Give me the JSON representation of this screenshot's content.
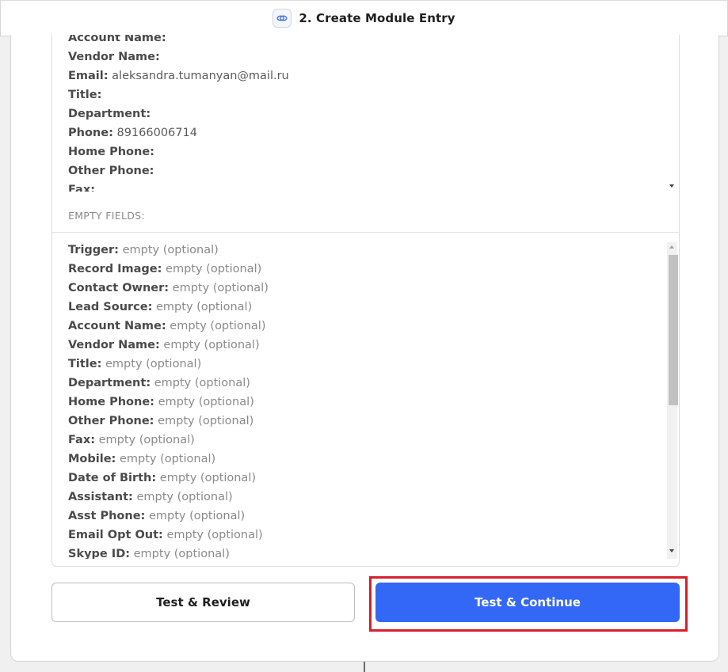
{
  "header": {
    "title": "2. Create Module Entry",
    "icon": "link-chain-icon"
  },
  "filled_fields": [
    {
      "label": "Account Name:",
      "value": ""
    },
    {
      "label": "Vendor Name:",
      "value": ""
    },
    {
      "label": "Email:",
      "value": "aleksandra.tumanyan@mail.ru"
    },
    {
      "label": "Title:",
      "value": ""
    },
    {
      "label": "Department:",
      "value": ""
    },
    {
      "label": "Phone:",
      "value": "89166006714"
    },
    {
      "label": "Home Phone:",
      "value": ""
    },
    {
      "label": "Other Phone:",
      "value": ""
    },
    {
      "label": "Fax:",
      "value": ""
    }
  ],
  "empty_section_label": "EMPTY FIELDS:",
  "empty_fields": [
    {
      "label": "Trigger:",
      "value": "empty (optional)"
    },
    {
      "label": "Record Image:",
      "value": "empty (optional)"
    },
    {
      "label": "Contact Owner:",
      "value": "empty (optional)"
    },
    {
      "label": "Lead Source:",
      "value": "empty (optional)"
    },
    {
      "label": "Account Name:",
      "value": "empty (optional)"
    },
    {
      "label": "Vendor Name:",
      "value": "empty (optional)"
    },
    {
      "label": "Title:",
      "value": "empty (optional)"
    },
    {
      "label": "Department:",
      "value": "empty (optional)"
    },
    {
      "label": "Home Phone:",
      "value": "empty (optional)"
    },
    {
      "label": "Other Phone:",
      "value": "empty (optional)"
    },
    {
      "label": "Fax:",
      "value": "empty (optional)"
    },
    {
      "label": "Mobile:",
      "value": "empty (optional)"
    },
    {
      "label": "Date of Birth:",
      "value": "empty (optional)"
    },
    {
      "label": "Assistant:",
      "value": "empty (optional)"
    },
    {
      "label": "Asst Phone:",
      "value": "empty (optional)"
    },
    {
      "label": "Email Opt Out:",
      "value": "empty (optional)"
    },
    {
      "label": "Skype ID:",
      "value": "empty (optional)"
    }
  ],
  "buttons": {
    "review": "Test & Review",
    "continue": "Test & Continue"
  },
  "colors": {
    "primary": "#3367f5",
    "highlight": "#d61f2c"
  }
}
